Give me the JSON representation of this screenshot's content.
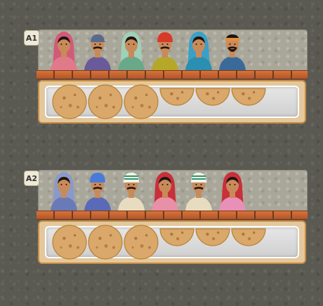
{
  "panels": [
    {
      "id": "A1",
      "label": "A1",
      "people": [
        {
          "role": "woman",
          "head_cover": "pink-dupatta",
          "clothing_color": "#e07a8a",
          "cover_color": "#d25a78"
        },
        {
          "role": "man",
          "head_cover": "cap",
          "clothing_color": "#6a5a9a",
          "cover_color": "#5a6a8a"
        },
        {
          "role": "woman",
          "head_cover": "green-dupatta",
          "clothing_color": "#6aa88a",
          "cover_color": "#9fd0b8"
        },
        {
          "role": "man",
          "head_cover": "red-turban",
          "clothing_color": "#b5a828",
          "cover_color": "#d83a2a"
        },
        {
          "role": "woman",
          "head_cover": "teal-dupatta",
          "clothing_color": "#2a8fb0",
          "cover_color": "#3aa0c8"
        },
        {
          "role": "man",
          "head_cover": "orange-headband",
          "clothing_color": "#3a6a9a",
          "cover_color": "#e09040"
        }
      ],
      "rotis": [
        {
          "portion": "whole"
        },
        {
          "portion": "whole"
        },
        {
          "portion": "whole"
        },
        {
          "portion": "half"
        },
        {
          "portion": "half"
        },
        {
          "portion": "half"
        }
      ]
    },
    {
      "id": "A2",
      "label": "A2",
      "people": [
        {
          "role": "woman",
          "head_cover": "blue-dupatta",
          "clothing_color": "#6a7ab8",
          "cover_color": "#8a9ac8"
        },
        {
          "role": "man",
          "head_cover": "blue-turban",
          "clothing_color": "#5a6ab8",
          "cover_color": "#4a7ad8"
        },
        {
          "role": "man",
          "head_cover": "white-striped-turban",
          "clothing_color": "#e8dcc0",
          "cover_color": "#f2f2ea"
        },
        {
          "role": "woman",
          "head_cover": "red-dupatta",
          "clothing_color": "#e890a8",
          "cover_color": "#c8303a"
        },
        {
          "role": "man",
          "head_cover": "white-striped-turban",
          "clothing_color": "#e8dcc0",
          "cover_color": "#f2f2ea"
        },
        {
          "role": "woman",
          "head_cover": "red-dupatta",
          "clothing_color": "#e890b8",
          "cover_color": "#c8303a"
        }
      ],
      "rotis": [
        {
          "portion": "whole"
        },
        {
          "portion": "whole"
        },
        {
          "portion": "whole"
        },
        {
          "portion": "half"
        },
        {
          "portion": "half"
        },
        {
          "portion": "half"
        }
      ]
    }
  ],
  "colors": {
    "roti": "#d9a86a",
    "roti_spots": "#a0602a",
    "skin": "#c98a5a",
    "hair": "#1e1410"
  }
}
